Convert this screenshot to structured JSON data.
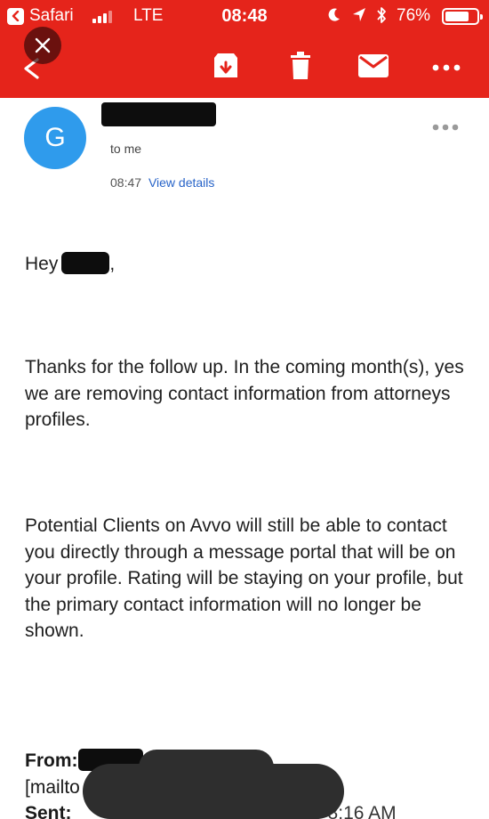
{
  "status_bar": {
    "back_app": "Safari",
    "carrier": "LTE",
    "time": "08:48",
    "battery": "76%",
    "battery_level": 0.76
  },
  "toolbar": {
    "icons": [
      "back-chevron-icon",
      "archive-icon",
      "delete-icon",
      "mark-unread-icon",
      "more-icon"
    ],
    "accent_color": "#e5241b"
  },
  "message": {
    "avatar_letter": "G",
    "avatar_color": "#2f9bec",
    "recipient": "to me",
    "time": "08:47",
    "view_details": "View details"
  },
  "body": {
    "greeting": "Hey",
    "greeting_suffix": ",",
    "paragraph_1": "Thanks for the follow up. In the coming month(s), yes we are removing contact information from attorneys profiles.",
    "paragraph_2": "Potential Clients on Avvo will still be able to contact you directly through a message portal that will be on your profile. Rating will be staying on your profile, but the primary contact information will no longer be shown."
  },
  "quoted_header": {
    "from_label": "From:",
    "mailto_fragment": "[mailto",
    "sent_label": "Sent:",
    "sent_fragment": "2016 8:16 AM"
  }
}
